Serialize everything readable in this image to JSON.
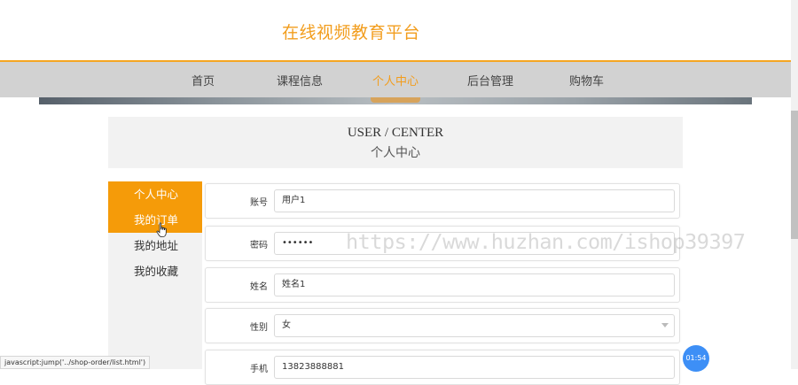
{
  "header": {
    "site_title": "在线视频教育平台"
  },
  "nav": {
    "items": [
      {
        "label": "首页"
      },
      {
        "label": "课程信息"
      },
      {
        "label": "个人中心",
        "active": true
      },
      {
        "label": "后台管理"
      },
      {
        "label": "购物车"
      }
    ]
  },
  "user_center": {
    "title_en": "USER / CENTER",
    "title_cn": "个人中心"
  },
  "side_menu": {
    "items": [
      {
        "label": "个人中心",
        "active": true
      },
      {
        "label": "我的订单",
        "hovered": true
      },
      {
        "label": "我的地址"
      },
      {
        "label": "我的收藏"
      }
    ]
  },
  "form": {
    "account": {
      "label": "账号",
      "value": "用户1"
    },
    "password": {
      "label": "密码",
      "value": "••••••"
    },
    "name": {
      "label": "姓名",
      "value": "姓名1"
    },
    "gender": {
      "label": "性别",
      "value": "女"
    },
    "phone": {
      "label": "手机",
      "value": "13823888881"
    }
  },
  "watermark": "https://www.huzhan.com/ishop39397",
  "status_bar": "javascript:jump('../shop-order/list.html')",
  "timer": "01:54",
  "colors": {
    "accent": "#f59b09",
    "nav_bg": "#d2d2d2",
    "panel_bg": "#f2f2f2",
    "badge": "#3d8ff6"
  }
}
